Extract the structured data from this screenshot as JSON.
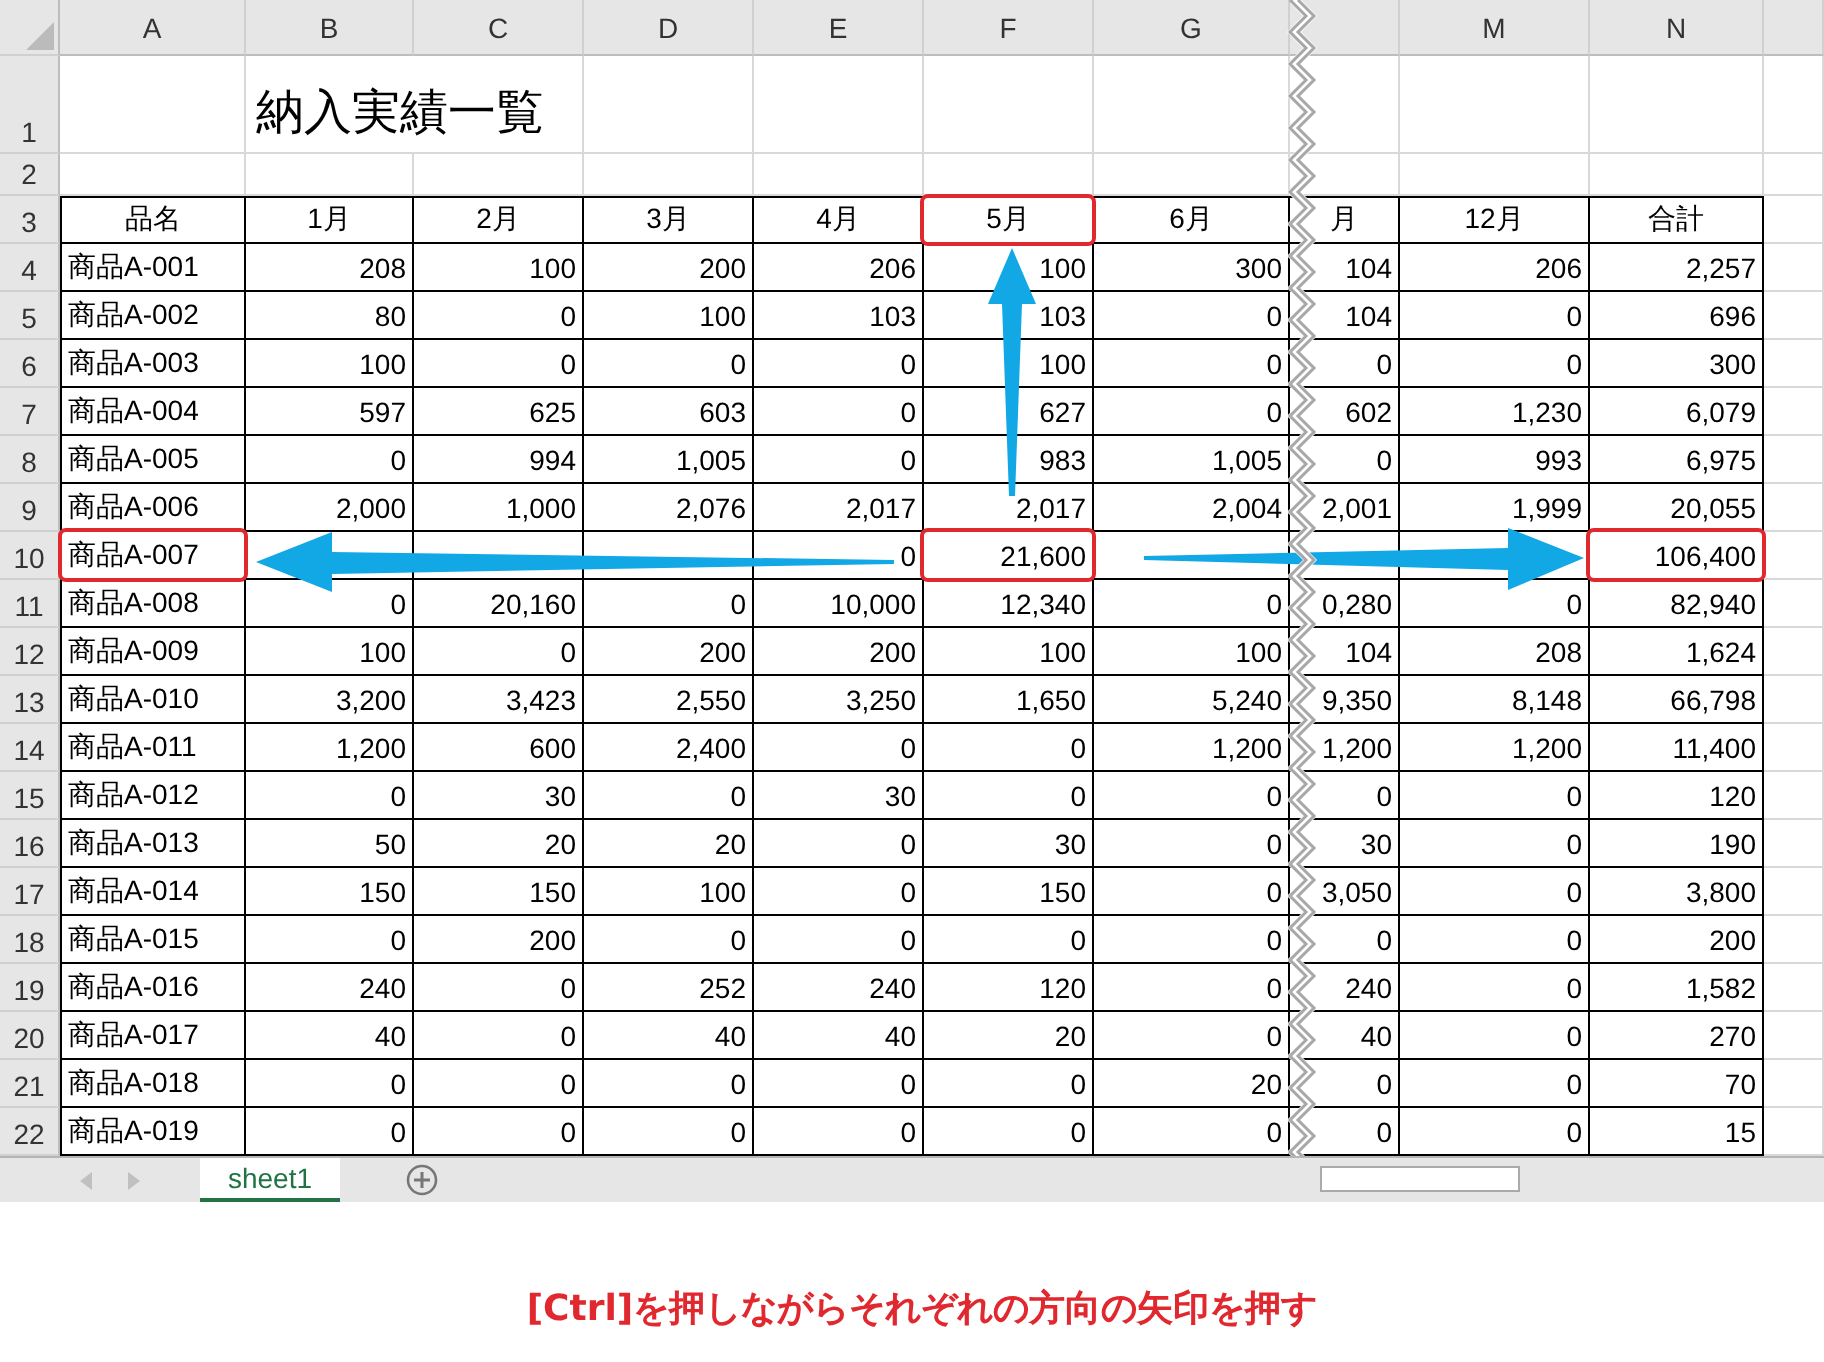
{
  "columns": [
    {
      "kind": "full",
      "label": "A"
    },
    {
      "kind": "full",
      "label": "B"
    },
    {
      "kind": "full",
      "label": "C"
    },
    {
      "kind": "full",
      "label": "D"
    },
    {
      "kind": "full",
      "label": "E"
    },
    {
      "kind": "full",
      "label": "F"
    },
    {
      "kind": "full",
      "label": "G"
    },
    {
      "kind": "partial"
    },
    {
      "kind": "full",
      "label": "M"
    },
    {
      "kind": "full",
      "label": "N"
    }
  ],
  "rows": [
    {
      "number": "1",
      "kind": "title",
      "title": "納入実績一覧"
    },
    {
      "number": "2",
      "kind": "blank"
    },
    {
      "number": "3",
      "kind": "header",
      "cells": [
        {
          "text": "品名",
          "highlighted": false
        },
        {
          "text": "1月",
          "highlighted": false
        },
        {
          "text": "2月",
          "highlighted": false
        },
        {
          "text": "3月",
          "highlighted": false
        },
        {
          "text": "4月",
          "highlighted": false
        },
        {
          "text": "5月",
          "highlighted": true
        },
        {
          "text": "6月",
          "highlighted": false
        },
        {
          "text": "月",
          "highlighted": false
        },
        {
          "text": "12月",
          "highlighted": false
        },
        {
          "text": "合計",
          "highlighted": false
        }
      ]
    },
    {
      "number": "4",
      "kind": "data",
      "cells": [
        {
          "text": "商品A-001",
          "highlighted": false
        },
        {
          "text": "208",
          "highlighted": false
        },
        {
          "text": "100",
          "highlighted": false
        },
        {
          "text": "200",
          "highlighted": false
        },
        {
          "text": "206",
          "highlighted": false
        },
        {
          "text": "100",
          "highlighted": false
        },
        {
          "text": "300",
          "highlighted": false
        },
        {
          "text": "104",
          "highlighted": false
        },
        {
          "text": "206",
          "highlighted": false
        },
        {
          "text": "2,257",
          "highlighted": false
        }
      ]
    },
    {
      "number": "5",
      "kind": "data",
      "cells": [
        {
          "text": "商品A-002",
          "highlighted": false
        },
        {
          "text": "80",
          "highlighted": false
        },
        {
          "text": "0",
          "highlighted": false
        },
        {
          "text": "100",
          "highlighted": false
        },
        {
          "text": "103",
          "highlighted": false
        },
        {
          "text": "103",
          "highlighted": false
        },
        {
          "text": "0",
          "highlighted": false
        },
        {
          "text": "104",
          "highlighted": false
        },
        {
          "text": "0",
          "highlighted": false
        },
        {
          "text": "696",
          "highlighted": false
        }
      ]
    },
    {
      "number": "6",
      "kind": "data",
      "cells": [
        {
          "text": "商品A-003",
          "highlighted": false
        },
        {
          "text": "100",
          "highlighted": false
        },
        {
          "text": "0",
          "highlighted": false
        },
        {
          "text": "0",
          "highlighted": false
        },
        {
          "text": "0",
          "highlighted": false
        },
        {
          "text": "100",
          "highlighted": false
        },
        {
          "text": "0",
          "highlighted": false
        },
        {
          "text": "0",
          "highlighted": false
        },
        {
          "text": "0",
          "highlighted": false
        },
        {
          "text": "300",
          "highlighted": false
        }
      ]
    },
    {
      "number": "7",
      "kind": "data",
      "cells": [
        {
          "text": "商品A-004",
          "highlighted": false
        },
        {
          "text": "597",
          "highlighted": false
        },
        {
          "text": "625",
          "highlighted": false
        },
        {
          "text": "603",
          "highlighted": false
        },
        {
          "text": "0",
          "highlighted": false
        },
        {
          "text": "627",
          "highlighted": false
        },
        {
          "text": "0",
          "highlighted": false
        },
        {
          "text": "602",
          "highlighted": false
        },
        {
          "text": "1,230",
          "highlighted": false
        },
        {
          "text": "6,079",
          "highlighted": false
        }
      ]
    },
    {
      "number": "8",
      "kind": "data",
      "cells": [
        {
          "text": "商品A-005",
          "highlighted": false
        },
        {
          "text": "0",
          "highlighted": false
        },
        {
          "text": "994",
          "highlighted": false
        },
        {
          "text": "1,005",
          "highlighted": false
        },
        {
          "text": "0",
          "highlighted": false
        },
        {
          "text": "983",
          "highlighted": false
        },
        {
          "text": "1,005",
          "highlighted": false
        },
        {
          "text": "0",
          "highlighted": false
        },
        {
          "text": "993",
          "highlighted": false
        },
        {
          "text": "6,975",
          "highlighted": false
        }
      ]
    },
    {
      "number": "9",
      "kind": "data",
      "cells": [
        {
          "text": "商品A-006",
          "highlighted": false
        },
        {
          "text": "2,000",
          "highlighted": false
        },
        {
          "text": "1,000",
          "highlighted": false
        },
        {
          "text": "2,076",
          "highlighted": false
        },
        {
          "text": "2,017",
          "highlighted": false
        },
        {
          "text": "2,017",
          "highlighted": false
        },
        {
          "text": "2,004",
          "highlighted": false
        },
        {
          "text": "2,001",
          "highlighted": false
        },
        {
          "text": "1,999",
          "highlighted": false
        },
        {
          "text": "20,055",
          "highlighted": false
        }
      ]
    },
    {
      "number": "10",
      "kind": "data",
      "cells": [
        {
          "text": "商品A-007",
          "highlighted": true
        },
        {
          "highlighted": false
        },
        {
          "highlighted": false
        },
        {
          "highlighted": false
        },
        {
          "text": "0",
          "highlighted": false
        },
        {
          "text": "21,600",
          "highlighted": true
        },
        {
          "highlighted": false
        },
        {
          "highlighted": false
        },
        {
          "highlighted": false
        },
        {
          "text": "106,400",
          "highlighted": true
        }
      ]
    },
    {
      "number": "11",
      "kind": "data",
      "cells": [
        {
          "text": "商品A-008",
          "highlighted": false
        },
        {
          "text": "0",
          "highlighted": false
        },
        {
          "text": "20,160",
          "highlighted": false
        },
        {
          "text": "0",
          "highlighted": false
        },
        {
          "text": "10,000",
          "highlighted": false
        },
        {
          "text": "12,340",
          "highlighted": false
        },
        {
          "text": "0",
          "highlighted": false
        },
        {
          "text": "0,280",
          "highlighted": false
        },
        {
          "text": "0",
          "highlighted": false
        },
        {
          "text": "82,940",
          "highlighted": false
        }
      ]
    },
    {
      "number": "12",
      "kind": "data",
      "cells": [
        {
          "text": "商品A-009",
          "highlighted": false
        },
        {
          "text": "100",
          "highlighted": false
        },
        {
          "text": "0",
          "highlighted": false
        },
        {
          "text": "200",
          "highlighted": false
        },
        {
          "text": "200",
          "highlighted": false
        },
        {
          "text": "100",
          "highlighted": false
        },
        {
          "text": "100",
          "highlighted": false
        },
        {
          "text": "104",
          "highlighted": false
        },
        {
          "text": "208",
          "highlighted": false
        },
        {
          "text": "1,624",
          "highlighted": false
        }
      ]
    },
    {
      "number": "13",
      "kind": "data",
      "cells": [
        {
          "text": "商品A-010",
          "highlighted": false
        },
        {
          "text": "3,200",
          "highlighted": false
        },
        {
          "text": "3,423",
          "highlighted": false
        },
        {
          "text": "2,550",
          "highlighted": false
        },
        {
          "text": "3,250",
          "highlighted": false
        },
        {
          "text": "1,650",
          "highlighted": false
        },
        {
          "text": "5,240",
          "highlighted": false
        },
        {
          "text": "9,350",
          "highlighted": false
        },
        {
          "text": "8,148",
          "highlighted": false
        },
        {
          "text": "66,798",
          "highlighted": false
        }
      ]
    },
    {
      "number": "14",
      "kind": "data",
      "cells": [
        {
          "text": "商品A-011",
          "highlighted": false
        },
        {
          "text": "1,200",
          "highlighted": false
        },
        {
          "text": "600",
          "highlighted": false
        },
        {
          "text": "2,400",
          "highlighted": false
        },
        {
          "text": "0",
          "highlighted": false
        },
        {
          "text": "0",
          "highlighted": false
        },
        {
          "text": "1,200",
          "highlighted": false
        },
        {
          "text": "1,200",
          "highlighted": false
        },
        {
          "text": "1,200",
          "highlighted": false
        },
        {
          "text": "11,400",
          "highlighted": false
        }
      ]
    },
    {
      "number": "15",
      "kind": "data",
      "cells": [
        {
          "text": "商品A-012",
          "highlighted": false
        },
        {
          "text": "0",
          "highlighted": false
        },
        {
          "text": "30",
          "highlighted": false
        },
        {
          "text": "0",
          "highlighted": false
        },
        {
          "text": "30",
          "highlighted": false
        },
        {
          "text": "0",
          "highlighted": false
        },
        {
          "text": "0",
          "highlighted": false
        },
        {
          "text": "0",
          "highlighted": false
        },
        {
          "text": "0",
          "highlighted": false
        },
        {
          "text": "120",
          "highlighted": false
        }
      ]
    },
    {
      "number": "16",
      "kind": "data",
      "cells": [
        {
          "text": "商品A-013",
          "highlighted": false
        },
        {
          "text": "50",
          "highlighted": false
        },
        {
          "text": "20",
          "highlighted": false
        },
        {
          "text": "20",
          "highlighted": false
        },
        {
          "text": "0",
          "highlighted": false
        },
        {
          "text": "30",
          "highlighted": false
        },
        {
          "text": "0",
          "highlighted": false
        },
        {
          "text": "30",
          "highlighted": false
        },
        {
          "text": "0",
          "highlighted": false
        },
        {
          "text": "190",
          "highlighted": false
        }
      ]
    },
    {
      "number": "17",
      "kind": "data",
      "cells": [
        {
          "text": "商品A-014",
          "highlighted": false
        },
        {
          "text": "150",
          "highlighted": false
        },
        {
          "text": "150",
          "highlighted": false
        },
        {
          "text": "100",
          "highlighted": false
        },
        {
          "text": "0",
          "highlighted": false
        },
        {
          "text": "150",
          "highlighted": false
        },
        {
          "text": "0",
          "highlighted": false
        },
        {
          "text": "3,050",
          "highlighted": false
        },
        {
          "text": "0",
          "highlighted": false
        },
        {
          "text": "3,800",
          "highlighted": false
        }
      ]
    },
    {
      "number": "18",
      "kind": "data",
      "cells": [
        {
          "text": "商品A-015",
          "highlighted": false
        },
        {
          "text": "0",
          "highlighted": false
        },
        {
          "text": "200",
          "highlighted": false
        },
        {
          "text": "0",
          "highlighted": false
        },
        {
          "text": "0",
          "highlighted": false
        },
        {
          "text": "0",
          "highlighted": false
        },
        {
          "text": "0",
          "highlighted": false
        },
        {
          "text": "0",
          "highlighted": false
        },
        {
          "text": "0",
          "highlighted": false
        },
        {
          "text": "200",
          "highlighted": false
        }
      ]
    },
    {
      "number": "19",
      "kind": "data",
      "cells": [
        {
          "text": "商品A-016",
          "highlighted": false
        },
        {
          "text": "240",
          "highlighted": false
        },
        {
          "text": "0",
          "highlighted": false
        },
        {
          "text": "252",
          "highlighted": false
        },
        {
          "text": "240",
          "highlighted": false
        },
        {
          "text": "120",
          "highlighted": false
        },
        {
          "text": "0",
          "highlighted": false
        },
        {
          "text": "240",
          "highlighted": false
        },
        {
          "text": "0",
          "highlighted": false
        },
        {
          "text": "1,582",
          "highlighted": false
        }
      ]
    },
    {
      "number": "20",
      "kind": "data",
      "cells": [
        {
          "text": "商品A-017",
          "highlighted": false
        },
        {
          "text": "40",
          "highlighted": false
        },
        {
          "text": "0",
          "highlighted": false
        },
        {
          "text": "40",
          "highlighted": false
        },
        {
          "text": "40",
          "highlighted": false
        },
        {
          "text": "20",
          "highlighted": false
        },
        {
          "text": "0",
          "highlighted": false
        },
        {
          "text": "40",
          "highlighted": false
        },
        {
          "text": "0",
          "highlighted": false
        },
        {
          "text": "270",
          "highlighted": false
        }
      ]
    },
    {
      "number": "21",
      "kind": "data",
      "cells": [
        {
          "text": "商品A-018",
          "highlighted": false
        },
        {
          "text": "0",
          "highlighted": false
        },
        {
          "text": "0",
          "highlighted": false
        },
        {
          "text": "0",
          "highlighted": false
        },
        {
          "text": "0",
          "highlighted": false
        },
        {
          "text": "0",
          "highlighted": false
        },
        {
          "text": "20",
          "highlighted": false
        },
        {
          "text": "0",
          "highlighted": false
        },
        {
          "text": "0",
          "highlighted": false
        },
        {
          "text": "70",
          "highlighted": false
        }
      ]
    },
    {
      "number": "22",
      "kind": "data",
      "cells": [
        {
          "text": "商品A-019",
          "highlighted": false
        },
        {
          "text": "0",
          "highlighted": false
        },
        {
          "text": "0",
          "highlighted": false
        },
        {
          "text": "0",
          "highlighted": false
        },
        {
          "text": "0",
          "highlighted": false
        },
        {
          "text": "0",
          "highlighted": false
        },
        {
          "text": "0",
          "highlighted": false
        },
        {
          "text": "0",
          "highlighted": false
        },
        {
          "text": "0",
          "highlighted": false
        },
        {
          "text": "15",
          "highlighted": false
        }
      ]
    }
  ],
  "arrows": [
    {
      "kind": "up"
    },
    {
      "kind": "left"
    },
    {
      "kind": "right"
    }
  ],
  "sheet_tabs": [
    {
      "label": "sheet1",
      "selected": true
    }
  ],
  "caption": "[Ctrl]を押しながらそれぞれの方向の矢印を押す"
}
